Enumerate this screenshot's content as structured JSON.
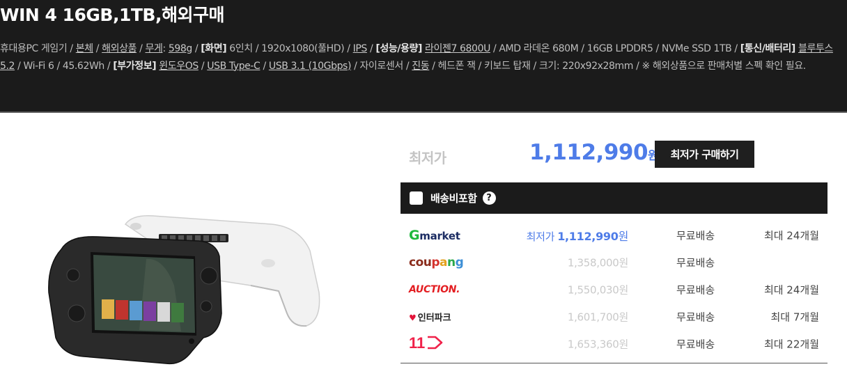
{
  "product": {
    "title": "WIN 4 16GB,1TB,해외구매",
    "specs": [
      {
        "t": "휴대용PC 게임기 / ",
        "s": ""
      },
      {
        "t": "본체",
        "s": "u"
      },
      {
        "t": " / ",
        "s": ""
      },
      {
        "t": "해외상품",
        "s": "u"
      },
      {
        "t": " / ",
        "s": ""
      },
      {
        "t": "무게",
        "s": "u"
      },
      {
        "t": ": ",
        "s": ""
      },
      {
        "t": "598g",
        "s": "u"
      },
      {
        "t": " / ",
        "s": ""
      },
      {
        "t": "[화면]",
        "s": "b"
      },
      {
        "t": " 6인치 / 1920x1080(풀HD) / ",
        "s": ""
      },
      {
        "t": "IPS",
        "s": "u"
      },
      {
        "t": " / ",
        "s": ""
      },
      {
        "t": "[성능/용량]",
        "s": "b"
      },
      {
        "t": " ",
        "s": ""
      },
      {
        "t": "라이젠7 6800U",
        "s": "u"
      },
      {
        "t": " / AMD 라데온 680M / 16GB LPDDR5 / NVMe SSD 1TB / ",
        "s": ""
      },
      {
        "t": "[통신/배터리]",
        "s": "b"
      },
      {
        "t": " ",
        "s": ""
      },
      {
        "t": "블루투스 5.2",
        "s": "u"
      },
      {
        "t": " / Wi-Fi 6 / 45.62Wh / ",
        "s": ""
      },
      {
        "t": "[부가정보]",
        "s": "b"
      },
      {
        "t": " ",
        "s": ""
      },
      {
        "t": "윈도우OS",
        "s": "u"
      },
      {
        "t": " / ",
        "s": ""
      },
      {
        "t": "USB Type-C",
        "s": "u"
      },
      {
        "t": " / ",
        "s": ""
      },
      {
        "t": "USB 3.1 (10Gbps)",
        "s": "u"
      },
      {
        "t": " / 자이로센서 / ",
        "s": ""
      },
      {
        "t": "진동",
        "s": "u"
      },
      {
        "t": " / 헤드폰 잭 / 키보드 탑재 / 크기: 220x92x28mm / ※ 해외상품으로 판매처별 스펙 확인 필요.",
        "s": ""
      }
    ]
  },
  "price_box": {
    "lowest_label": "최저가",
    "lowest_price": "1,112,990",
    "won": "원",
    "buy_button": "최저가 구매하기"
  },
  "shipping": {
    "label": "배송비포함",
    "help": "?"
  },
  "sellers": [
    {
      "name": "Gmarket",
      "best_tag": "최저가",
      "price": "1,112,990",
      "won": "원",
      "ship": "무료배송",
      "inst": "최대 24개월",
      "best": true
    },
    {
      "name": "coupang",
      "best_tag": "",
      "price": "1,358,000",
      "won": "원",
      "ship": "무료배송",
      "inst": "",
      "best": false
    },
    {
      "name": "AUCTION.",
      "best_tag": "",
      "price": "1,550,030",
      "won": "원",
      "ship": "무료배송",
      "inst": "최대 24개월",
      "best": false
    },
    {
      "name": "인터파크",
      "best_tag": "",
      "price": "1,601,700",
      "won": "원",
      "ship": "무료배송",
      "inst": "최대 7개월",
      "best": false
    },
    {
      "name": "11",
      "best_tag": "",
      "price": "1,653,360",
      "won": "원",
      "ship": "무료배송",
      "inst": "최대 22개월",
      "best": false
    }
  ],
  "colors": {
    "accent_blue": "#4e7ce8",
    "header_bg": "#1b1b1b",
    "gmarket_green": "#1eb83c",
    "auction_red": "#e31d21",
    "st11_red": "#f0224a"
  }
}
